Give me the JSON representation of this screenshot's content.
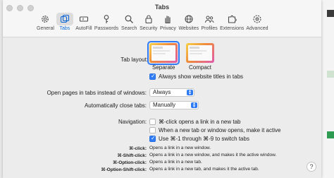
{
  "window": {
    "title": "Tabs"
  },
  "toolbar": {
    "items": [
      {
        "label": "General",
        "icon": "gear-icon"
      },
      {
        "label": "Tabs",
        "icon": "tabs-icon",
        "active": true
      },
      {
        "label": "AutoFill",
        "icon": "autofill-icon"
      },
      {
        "label": "Passwords",
        "icon": "key-icon"
      },
      {
        "label": "Search",
        "icon": "search-icon"
      },
      {
        "label": "Security",
        "icon": "lock-icon"
      },
      {
        "label": "Privacy",
        "icon": "hand-icon"
      },
      {
        "label": "Websites",
        "icon": "globe-icon"
      },
      {
        "label": "Profiles",
        "icon": "profiles-icon"
      },
      {
        "label": "Extensions",
        "icon": "puzzle-icon"
      },
      {
        "label": "Advanced",
        "icon": "advanced-gear-icon"
      }
    ]
  },
  "tab_layout": {
    "label": "Tab layout:",
    "separate_label": "Separate",
    "compact_label": "Compact",
    "selected": "Separate",
    "always_show_titles": {
      "label": "Always show website titles in tabs",
      "checked": true
    }
  },
  "open_pages": {
    "label": "Open pages in tabs instead of windows:",
    "value": "Always"
  },
  "auto_close": {
    "label": "Automatically close tabs:",
    "value": "Manually"
  },
  "navigation": {
    "label": "Navigation:",
    "options": [
      {
        "label": "⌘-click opens a link in a new tab",
        "checked": false
      },
      {
        "label": "When a new tab or window opens, make it active",
        "checked": false
      },
      {
        "label": "Use ⌘-1 through ⌘-9 to switch tabs",
        "checked": true
      }
    ]
  },
  "shortcuts": [
    {
      "key": "⌘-click:",
      "desc": "Opens a link in a new window."
    },
    {
      "key": "⌘-Shift-click:",
      "desc": "Opens a link in a new window, and makes it the active window."
    },
    {
      "key": "⌘-Option-click:",
      "desc": "Opens a link in a new tab."
    },
    {
      "key": "⌘-Option-Shift-click:",
      "desc": "Opens a link in a new tab, and makes it the active tab."
    }
  ],
  "help": {
    "label": "?"
  },
  "colors": {
    "accent": "#2f7bf5",
    "window_bg": "#ececec",
    "titlebar_bg": "#f6f6f6"
  }
}
